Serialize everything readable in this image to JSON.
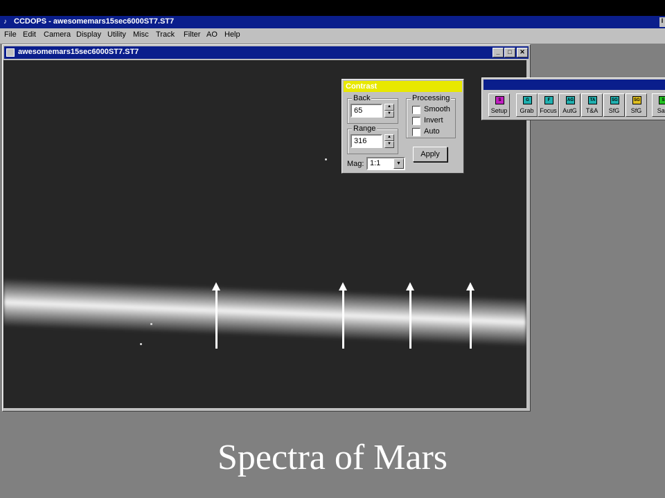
{
  "app": {
    "title": "CCDOPS - awesomemars15sec6000ST7.ST7",
    "edge_button": "I"
  },
  "menu": [
    "File",
    "Edit",
    "Camera",
    "Display",
    "Utility",
    "Misc",
    "Track",
    "Filter",
    "AO",
    "Help"
  ],
  "image_window": {
    "title": "awesomemars15sec6000ST7.ST7",
    "min_label": "_",
    "max_label": "□",
    "close_label": "✕"
  },
  "contrast": {
    "title": "Contrast",
    "back_label": "Back",
    "back_value": "65",
    "range_label": "Range",
    "range_value": "316",
    "processing_label": "Processing",
    "smooth_label": "Smooth",
    "invert_label": "Invert",
    "auto_label": "Auto",
    "apply_label": "Apply",
    "mag_label": "Mag:",
    "mag_value": "1:1"
  },
  "toolbar": {
    "buttons": [
      {
        "icon": "S",
        "label": "Setup",
        "color": "#c020c0"
      },
      {
        "icon": "G",
        "label": "Grab",
        "color": "#20b0b0"
      },
      {
        "icon": "F",
        "label": "Focus",
        "color": "#20b0b0"
      },
      {
        "icon": "AG",
        "label": "AutG",
        "color": "#20b0b0"
      },
      {
        "icon": "TA",
        "label": "T&A",
        "color": "#20b0b0"
      },
      {
        "icon": "SG",
        "label": "SfG",
        "color": "#20b0b0"
      },
      {
        "icon": "SG",
        "label": "SfG",
        "color": "#e0c020"
      },
      {
        "icon": "S",
        "label": "Sav",
        "color": "#20c020"
      }
    ]
  },
  "caption": "Spectra of Mars",
  "colors": {
    "titlebar": "#0a1e8c",
    "contrast_titlebar": "#e8e800",
    "desktop": "#808080",
    "image_bg": "#262626"
  }
}
